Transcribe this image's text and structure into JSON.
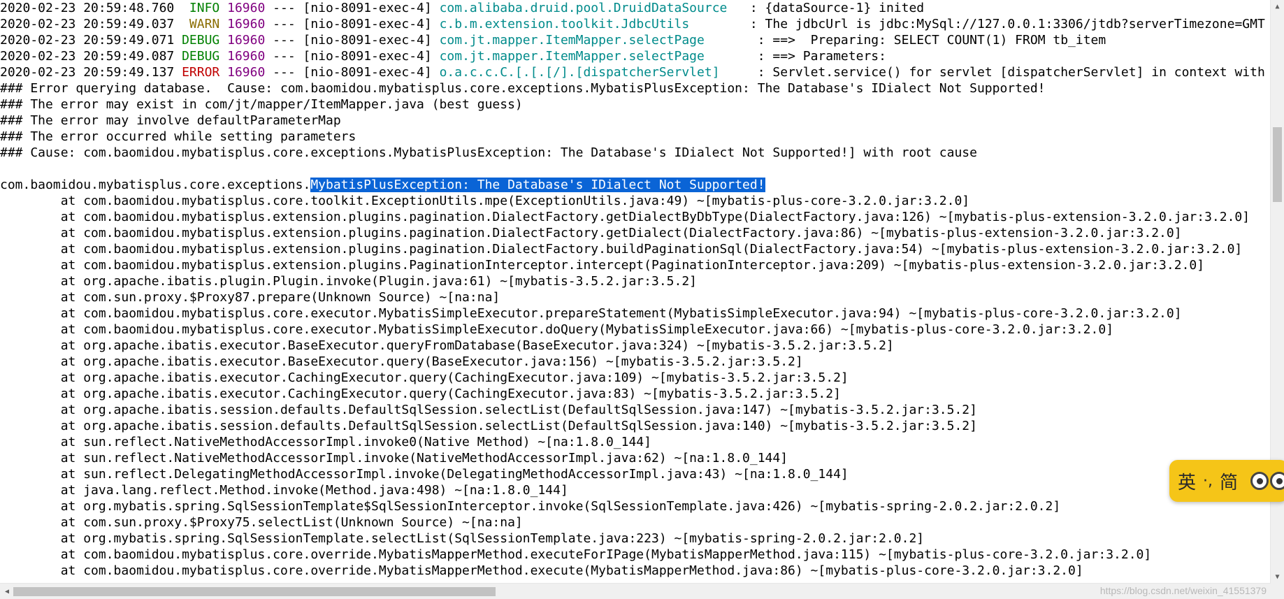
{
  "log_lines": [
    {
      "type": "log",
      "ts": "2020-02-23 20:59:48.760",
      "level": "  INFO",
      "level_class": "lvl-info",
      "pid": "16960",
      "thread": " --- [nio-8091-exec-4] ",
      "logger": "com.alibaba.druid.pool.DruidDataSource  ",
      "msg": " : {dataSource-1} inited"
    },
    {
      "type": "log",
      "ts": "2020-02-23 20:59:49.037",
      "level": "  WARN",
      "level_class": "lvl-warn",
      "pid": "16960",
      "thread": " --- [nio-8091-exec-4] ",
      "logger": "c.b.m.extension.toolkit.JdbcUtils       ",
      "msg": " : The jdbcUrl is jdbc:MySql://127.0.0.1:3306/jtdb?serverTimezone=GMT"
    },
    {
      "type": "log",
      "ts": "2020-02-23 20:59:49.071",
      "level": " DEBUG",
      "level_class": "lvl-debug",
      "pid": "16960",
      "thread": " --- [nio-8091-exec-4] ",
      "logger": "com.jt.mapper.ItemMapper.selectPage      ",
      "msg": " : ==>  Preparing: SELECT COUNT(1) FROM tb_item"
    },
    {
      "type": "log",
      "ts": "2020-02-23 20:59:49.087",
      "level": " DEBUG",
      "level_class": "lvl-debug",
      "pid": "16960",
      "thread": " --- [nio-8091-exec-4] ",
      "logger": "com.jt.mapper.ItemMapper.selectPage      ",
      "msg": " : ==> Parameters:"
    },
    {
      "type": "log",
      "ts": "2020-02-23 20:59:49.137",
      "level": " ERROR",
      "level_class": "lvl-error",
      "pid": "16960",
      "thread": " --- [nio-8091-exec-4] ",
      "logger": "o.a.c.c.C.[.[.[/].[dispatcherServlet]    ",
      "msg": " : Servlet.service() for servlet [dispatcherServlet] in context with path [] threw exception"
    },
    {
      "type": "text",
      "text": "### Error querying database.  Cause: com.baomidou.mybatisplus.core.exceptions.MybatisPlusException: The Database's IDialect Not Supported!"
    },
    {
      "type": "text",
      "text": "### The error may exist in com/jt/mapper/ItemMapper.java (best guess)"
    },
    {
      "type": "text",
      "text": "### The error may involve defaultParameterMap"
    },
    {
      "type": "text",
      "text": "### The error occurred while setting parameters"
    },
    {
      "type": "text",
      "text": "### Cause: com.baomidou.mybatisplus.core.exceptions.MybatisPlusException: The Database's IDialect Not Supported!] with root cause"
    },
    {
      "type": "text",
      "text": ""
    },
    {
      "type": "selected",
      "pre": "com.baomidou.mybatisplus.core.exceptions.",
      "sel": "MybatisPlusException: The Database's IDialect Not Supported!"
    },
    {
      "type": "text",
      "text": "\tat com.baomidou.mybatisplus.core.toolkit.ExceptionUtils.mpe(ExceptionUtils.java:49) ~[mybatis-plus-core-3.2.0.jar:3.2.0]"
    },
    {
      "type": "text",
      "text": "\tat com.baomidou.mybatisplus.extension.plugins.pagination.DialectFactory.getDialectByDbType(DialectFactory.java:126) ~[mybatis-plus-extension-3.2.0.jar:3.2.0]"
    },
    {
      "type": "text",
      "text": "\tat com.baomidou.mybatisplus.extension.plugins.pagination.DialectFactory.getDialect(DialectFactory.java:86) ~[mybatis-plus-extension-3.2.0.jar:3.2.0]"
    },
    {
      "type": "text",
      "text": "\tat com.baomidou.mybatisplus.extension.plugins.pagination.DialectFactory.buildPaginationSql(DialectFactory.java:54) ~[mybatis-plus-extension-3.2.0.jar:3.2.0]"
    },
    {
      "type": "text",
      "text": "\tat com.baomidou.mybatisplus.extension.plugins.PaginationInterceptor.intercept(PaginationInterceptor.java:209) ~[mybatis-plus-extension-3.2.0.jar:3.2.0]"
    },
    {
      "type": "text",
      "text": "\tat org.apache.ibatis.plugin.Plugin.invoke(Plugin.java:61) ~[mybatis-3.5.2.jar:3.5.2]"
    },
    {
      "type": "text",
      "text": "\tat com.sun.proxy.$Proxy87.prepare(Unknown Source) ~[na:na]"
    },
    {
      "type": "text",
      "text": "\tat com.baomidou.mybatisplus.core.executor.MybatisSimpleExecutor.prepareStatement(MybatisSimpleExecutor.java:94) ~[mybatis-plus-core-3.2.0.jar:3.2.0]"
    },
    {
      "type": "text",
      "text": "\tat com.baomidou.mybatisplus.core.executor.MybatisSimpleExecutor.doQuery(MybatisSimpleExecutor.java:66) ~[mybatis-plus-core-3.2.0.jar:3.2.0]"
    },
    {
      "type": "text",
      "text": "\tat org.apache.ibatis.executor.BaseExecutor.queryFromDatabase(BaseExecutor.java:324) ~[mybatis-3.5.2.jar:3.5.2]"
    },
    {
      "type": "text",
      "text": "\tat org.apache.ibatis.executor.BaseExecutor.query(BaseExecutor.java:156) ~[mybatis-3.5.2.jar:3.5.2]"
    },
    {
      "type": "text",
      "text": "\tat org.apache.ibatis.executor.CachingExecutor.query(CachingExecutor.java:109) ~[mybatis-3.5.2.jar:3.5.2]"
    },
    {
      "type": "text",
      "text": "\tat org.apache.ibatis.executor.CachingExecutor.query(CachingExecutor.java:83) ~[mybatis-3.5.2.jar:3.5.2]"
    },
    {
      "type": "text",
      "text": "\tat org.apache.ibatis.session.defaults.DefaultSqlSession.selectList(DefaultSqlSession.java:147) ~[mybatis-3.5.2.jar:3.5.2]"
    },
    {
      "type": "text",
      "text": "\tat org.apache.ibatis.session.defaults.DefaultSqlSession.selectList(DefaultSqlSession.java:140) ~[mybatis-3.5.2.jar:3.5.2]"
    },
    {
      "type": "text",
      "text": "\tat sun.reflect.NativeMethodAccessorImpl.invoke0(Native Method) ~[na:1.8.0_144]"
    },
    {
      "type": "text",
      "text": "\tat sun.reflect.NativeMethodAccessorImpl.invoke(NativeMethodAccessorImpl.java:62) ~[na:1.8.0_144]"
    },
    {
      "type": "text",
      "text": "\tat sun.reflect.DelegatingMethodAccessorImpl.invoke(DelegatingMethodAccessorImpl.java:43) ~[na:1.8.0_144]"
    },
    {
      "type": "text",
      "text": "\tat java.lang.reflect.Method.invoke(Method.java:498) ~[na:1.8.0_144]"
    },
    {
      "type": "text",
      "text": "\tat org.mybatis.spring.SqlSessionTemplate$SqlSessionInterceptor.invoke(SqlSessionTemplate.java:426) ~[mybatis-spring-2.0.2.jar:2.0.2]"
    },
    {
      "type": "text",
      "text": "\tat com.sun.proxy.$Proxy75.selectList(Unknown Source) ~[na:na]"
    },
    {
      "type": "text",
      "text": "\tat org.mybatis.spring.SqlSessionTemplate.selectList(SqlSessionTemplate.java:223) ~[mybatis-spring-2.0.2.jar:2.0.2]"
    },
    {
      "type": "text",
      "text": "\tat com.baomidou.mybatisplus.core.override.MybatisMapperMethod.executeForIPage(MybatisMapperMethod.java:115) ~[mybatis-plus-core-3.2.0.jar:3.2.0]"
    },
    {
      "type": "text",
      "text": "\tat com.baomidou.mybatisplus.core.override.MybatisMapperMethod.execute(MybatisMapperMethod.java:86) ~[mybatis-plus-core-3.2.0.jar:3.2.0]"
    }
  ],
  "ime": {
    "lang": "英",
    "sep": "·,",
    "mode": "简"
  },
  "watermark": "https://blog.csdn.net/weixin_41551379",
  "icons": {
    "scroll_up": "▲",
    "scroll_down": "▼",
    "scroll_left": "◀"
  },
  "colors": {
    "selection": "#0a64d6",
    "ime_bg": "#f5c518",
    "error": "#c00000",
    "info": "#008000",
    "logger": "#008b8b",
    "pid": "#800080"
  }
}
